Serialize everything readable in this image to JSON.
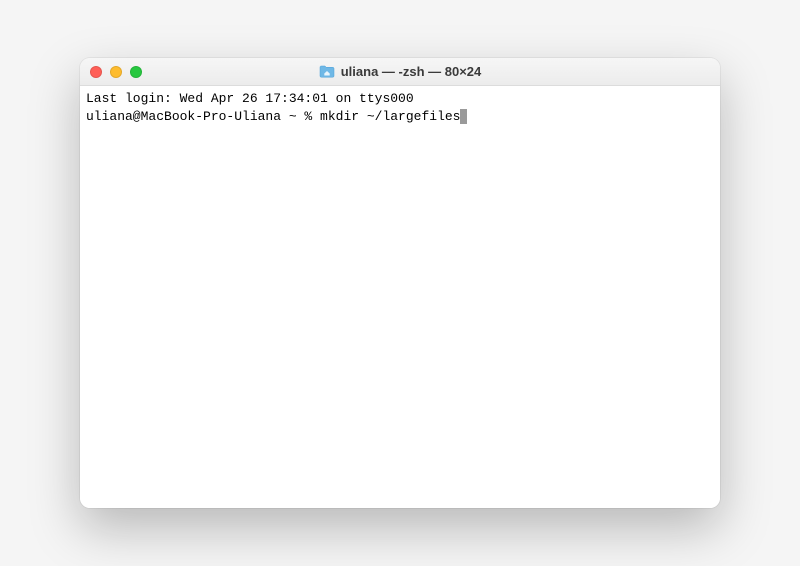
{
  "window": {
    "title": "uliana — -zsh — 80×24"
  },
  "terminal": {
    "last_login_line": "Last login: Wed Apr 26 17:34:01 on ttys000",
    "prompt": "uliana@MacBook-Pro-Uliana ~ % ",
    "command": "mkdir ~/largefiles"
  }
}
